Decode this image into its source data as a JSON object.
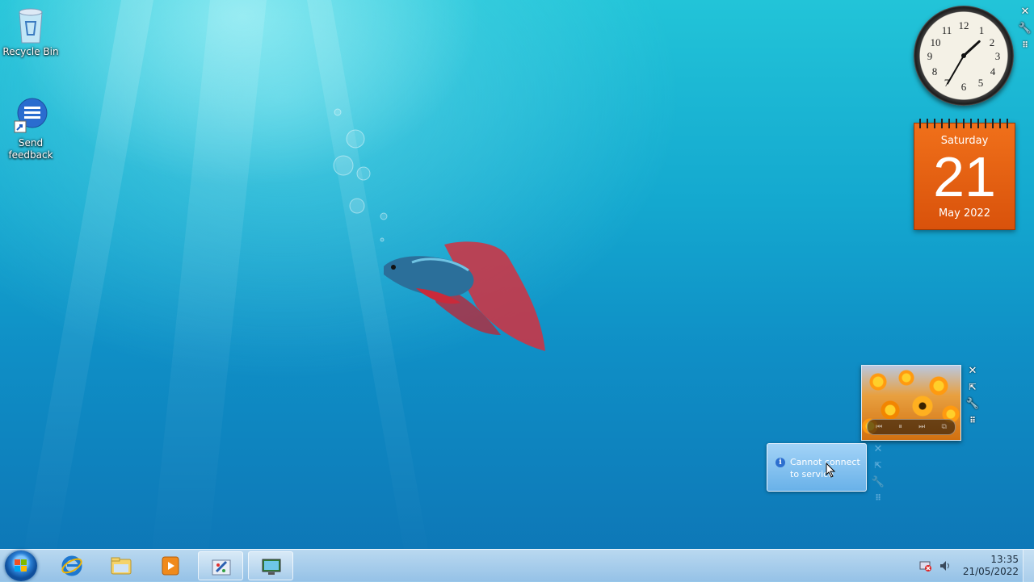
{
  "desktop": {
    "icons": [
      {
        "label": "Recycle Bin"
      },
      {
        "label": "Send feedback"
      }
    ]
  },
  "gadgets": {
    "calendar": {
      "weekday": "Saturday",
      "day": "21",
      "month_year": "May 2022"
    },
    "clock": {
      "numbers": [
        "12",
        "1",
        "2",
        "3",
        "4",
        "5",
        "6",
        "7",
        "8",
        "9",
        "10",
        "11"
      ],
      "time": "13:35"
    },
    "feed": {
      "message": "Cannot connect to service"
    }
  },
  "taskbar": {
    "apps": [
      "internet-explorer",
      "windows-explorer",
      "media-player",
      "paint",
      "remote-desktop"
    ],
    "tray": {
      "time": "13:35",
      "date": "21/05/2022"
    }
  },
  "colors": {
    "calendar": "#e8630f",
    "taskbar": "#b4d4ef"
  }
}
